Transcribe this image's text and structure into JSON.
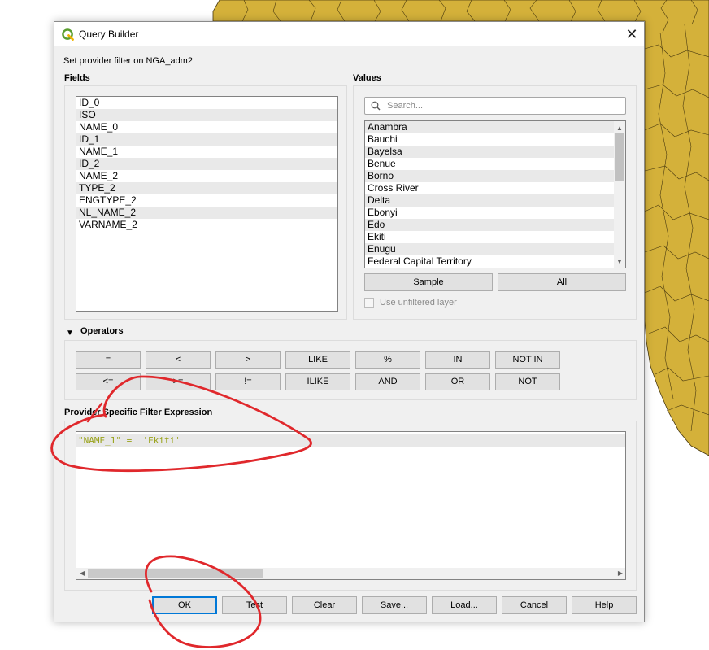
{
  "dialog": {
    "title": "Query Builder",
    "subtitle": "Set provider filter on NGA_adm2",
    "close_glyph": "✕"
  },
  "fields": {
    "heading": "Fields",
    "items": [
      "ID_0",
      "ISO",
      "NAME_0",
      "ID_1",
      "NAME_1",
      "ID_2",
      "NAME_2",
      "TYPE_2",
      "ENGTYPE_2",
      "NL_NAME_2",
      "VARNAME_2"
    ]
  },
  "values": {
    "heading": "Values",
    "search_placeholder": "Search...",
    "items": [
      "Anambra",
      "Bauchi",
      "Bayelsa",
      "Benue",
      "Borno",
      "Cross River",
      "Delta",
      "Ebonyi",
      "Edo",
      "Ekiti",
      "Enugu",
      "Federal Capital Territory"
    ],
    "sample_label": "Sample",
    "all_label": "All",
    "unfiltered_label": "Use unfiltered layer",
    "unfiltered_checked": false
  },
  "operators": {
    "heading": "Operators",
    "row1": [
      "=",
      "<",
      ">",
      "LIKE",
      "%",
      "IN",
      "NOT IN"
    ],
    "row2": [
      "<=",
      ">=",
      "!=",
      "ILIKE",
      "AND",
      "OR",
      "NOT"
    ]
  },
  "expression": {
    "heading": "Provider Specific Filter Expression",
    "text": "\"NAME_1\" =  'Ekiti'"
  },
  "buttons": {
    "ok": "OK",
    "test": "Test",
    "clear": "Clear",
    "save": "Save...",
    "load": "Load...",
    "cancel": "Cancel",
    "help": "Help"
  },
  "colors": {
    "map_fill": "#d4b13a",
    "expression_text": "#9aa31c",
    "annotation": "#e0282c"
  }
}
